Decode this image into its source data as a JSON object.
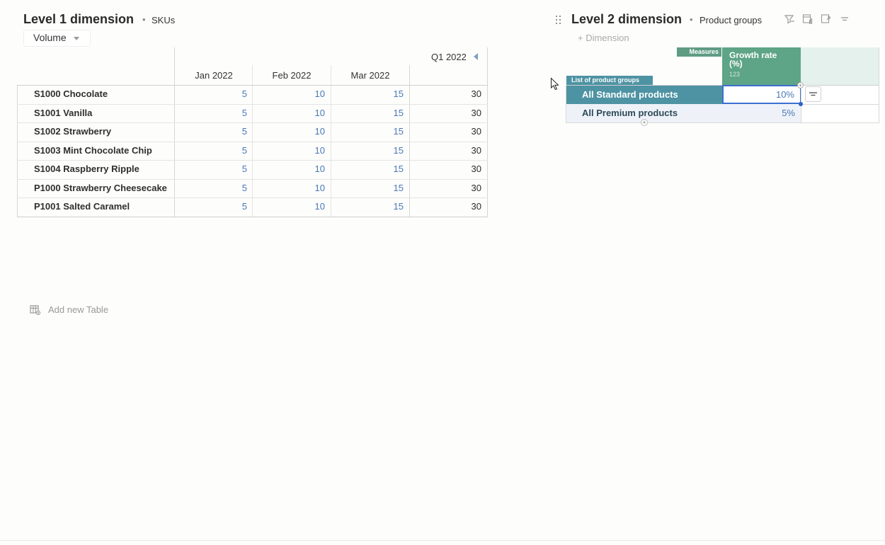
{
  "table1": {
    "title": "Level 1 dimension",
    "separator": "•",
    "subtitle": "SKUs",
    "selector_value": "Volume",
    "quarter_label": "Q1 2022",
    "columns": [
      "Jan 2022",
      "Feb 2022",
      "Mar 2022"
    ],
    "rows": [
      {
        "label": "S1000 Chocolate",
        "values": [
          "5",
          "10",
          "15"
        ],
        "total": "30"
      },
      {
        "label": "S1001 Vanilla",
        "values": [
          "5",
          "10",
          "15"
        ],
        "total": "30"
      },
      {
        "label": "S1002 Strawberry",
        "values": [
          "5",
          "10",
          "15"
        ],
        "total": "30"
      },
      {
        "label": "S1003 Mint Chocolate Chip",
        "values": [
          "5",
          "10",
          "15"
        ],
        "total": "30"
      },
      {
        "label": "S1004 Raspberry Ripple",
        "values": [
          "5",
          "10",
          "15"
        ],
        "total": "30"
      },
      {
        "label": "P1000 Strawberry Cheesecake",
        "values": [
          "5",
          "10",
          "15"
        ],
        "total": "30"
      },
      {
        "label": "P1001 Salted Caramel",
        "values": [
          "5",
          "10",
          "15"
        ],
        "total": "30"
      }
    ]
  },
  "add_table": {
    "label": "Add new Table"
  },
  "table2": {
    "title": "Level 2 dimension",
    "separator": "•",
    "subtitle": "Product groups",
    "add_dimension": "+ Dimension",
    "measures_tag": "Measures",
    "list_tag": "List of product groups",
    "measure": {
      "label": "Growth rate (%)",
      "type": "123"
    },
    "rows": [
      {
        "label": "All Standard products",
        "value": "10%"
      },
      {
        "label": "All Premium products",
        "value": "5%"
      }
    ]
  },
  "colors": {
    "measure_header": "#5ea486",
    "measures_tag": "#5e9c83",
    "row_header_selected": "#4e93a3",
    "value_blue": "#4a78b4",
    "selection_blue": "#3c6fd1"
  }
}
